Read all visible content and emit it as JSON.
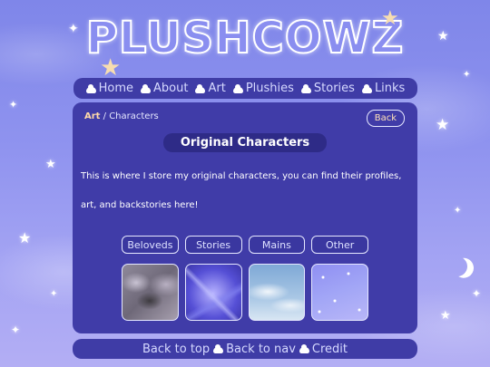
{
  "site": {
    "logo_text": "PLUSHCOWZ"
  },
  "nav": {
    "items": [
      {
        "label": "Home"
      },
      {
        "label": "About"
      },
      {
        "label": "Art"
      },
      {
        "label": "Plushies"
      },
      {
        "label": "Stories"
      },
      {
        "label": "Links"
      }
    ]
  },
  "breadcrumb": {
    "parent": "Art",
    "separator": " / ",
    "current": "Characters"
  },
  "back_button": "Back",
  "page": {
    "title": "Original Characters",
    "intro": "This is where I store my original characters, you can find their profiles, art, and backstories here!"
  },
  "categories": [
    {
      "label": "Beloveds"
    },
    {
      "label": "Stories"
    },
    {
      "label": "Mains"
    },
    {
      "label": "Other"
    }
  ],
  "footer": {
    "links": [
      {
        "label": "Back to top"
      },
      {
        "label": "Back to nav"
      },
      {
        "label": "Credit"
      }
    ]
  },
  "colors": {
    "background": "#8f93ef",
    "panel": "#403ca8",
    "title_pill": "#2e2b87",
    "accent_peach": "#ffd9a8",
    "text_light": "#d6d9ff"
  },
  "icons": {
    "nav_bullet": "cloud-icon",
    "decoration": "star-icon",
    "moon": "moon-icon"
  }
}
